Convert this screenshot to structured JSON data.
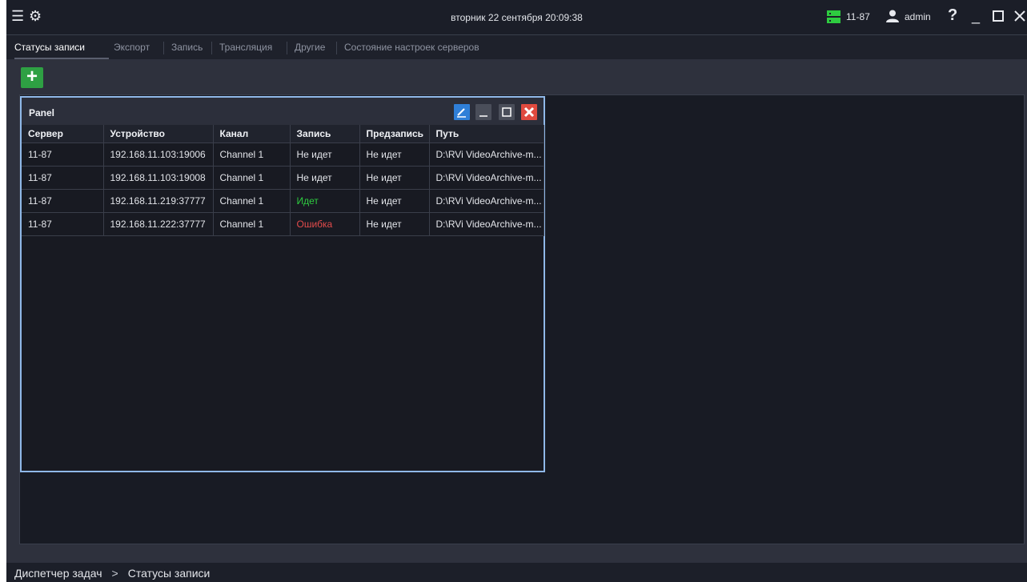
{
  "titlebar": {
    "datetime": "вторник 22 сентября 20:09:38",
    "server": "11-87",
    "user": "admin",
    "help_glyph": "?",
    "menu_icon": "hamburger-menu-icon",
    "settings_icon": "gear-icon"
  },
  "tabs": [
    {
      "label": "Статусы записи",
      "active": true
    },
    {
      "label": "Экспорт"
    },
    {
      "label": "Запись"
    },
    {
      "label": "Трансляция"
    },
    {
      "label": "Другие"
    },
    {
      "label": "Состояние настроек серверов"
    }
  ],
  "toolbar": {
    "add_glyph": "+"
  },
  "panel": {
    "title": "Panel",
    "columns": [
      "Сервер",
      "Устройство",
      "Канал",
      "Запись",
      "Предзапись",
      "Путь"
    ],
    "rows": [
      [
        "11-87",
        "192.168.11.103:19006",
        "Channel 1",
        "Не идет",
        "Не идет",
        "D:\\RVi VideoArchive-m..."
      ],
      [
        "11-87",
        "192.168.11.103:19008",
        "Channel 1",
        "Не идет",
        "Не идет",
        "D:\\RVi VideoArchive-m..."
      ],
      [
        "11-87",
        "192.168.11.219:37777",
        "Channel 1",
        "Идет",
        "Не идет",
        "D:\\RVi VideoArchive-m..."
      ],
      [
        "11-87",
        "192.168.11.222:37777",
        "Channel 1",
        "Ошибка",
        "Не идет",
        "D:\\RVi VideoArchive-m..."
      ]
    ]
  },
  "breadcrumb": {
    "root": "Диспетчер задач",
    "separator": ">",
    "current": "Статусы записи"
  },
  "colors": {
    "status_ok": "#2ecc40",
    "status_error": "#e34b4b",
    "accent_green": "#2ea043",
    "panel_border": "#8fb8e8"
  }
}
